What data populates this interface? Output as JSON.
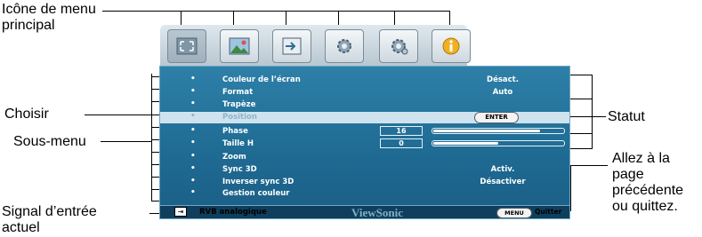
{
  "callouts": {
    "main_menu_icon": [
      "Icône de menu",
      "principal"
    ],
    "select": "Choisir",
    "submenu": "Sous-menu",
    "current_input": [
      "Signal d’entrée",
      "actuel"
    ],
    "status": "Statut",
    "back_or_quit": [
      "Allez à la",
      "page",
      "précédente",
      "ou quittez."
    ]
  },
  "tabs": [
    {
      "icon": "display-icon",
      "active": true
    },
    {
      "icon": "picture-icon",
      "active": false
    },
    {
      "icon": "source-icon",
      "active": false
    },
    {
      "icon": "system-setup-basic-icon",
      "active": false
    },
    {
      "icon": "system-setup-advanced-icon",
      "active": false
    },
    {
      "icon": "information-icon",
      "active": false
    }
  ],
  "menu_items": [
    {
      "label": "Couleur de l’écran",
      "value": "Désact."
    },
    {
      "label": "Format",
      "value": "Auto"
    },
    {
      "label": "Trapèze",
      "value": ""
    },
    {
      "label": "Position",
      "value": "ENTER",
      "selected": true
    },
    {
      "label": "Phase",
      "value": "16",
      "bar_fraction": 0.82
    },
    {
      "label": "Taille H",
      "value": "0",
      "bar_fraction": 0.5
    },
    {
      "label": "Zoom",
      "value": ""
    },
    {
      "label": "Sync 3D",
      "value": "Activ."
    },
    {
      "label": "Inverser sync 3D",
      "value": "Désactiver"
    },
    {
      "label": "Gestion couleur",
      "value": ""
    }
  ],
  "footer": {
    "signal": "RVB analogique",
    "brand": "ViewSonic",
    "menu_button": "MENU",
    "quit": "Quitter"
  },
  "colors": {
    "panel": "#2e80a8",
    "selected_row": "#cfe3ef",
    "footer": "#0f3f5d"
  }
}
